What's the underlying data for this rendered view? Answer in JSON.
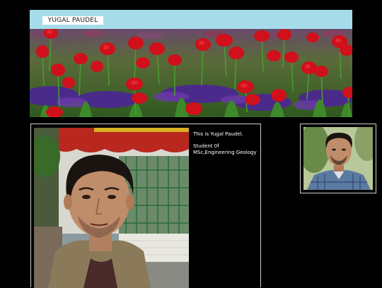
{
  "header": {
    "site_title": "YUGAL PAUDEL"
  },
  "banner": {
    "image": "red-tulip-field-banner"
  },
  "profile": {
    "intro": "This is Yugal Paudel.",
    "role_line": "Student 0f",
    "degree_line": "MSc,Engineering Geology"
  },
  "colors": {
    "header_bar": "#a6dcea",
    "background": "#000000",
    "panel_border": "#cfcfcf"
  }
}
